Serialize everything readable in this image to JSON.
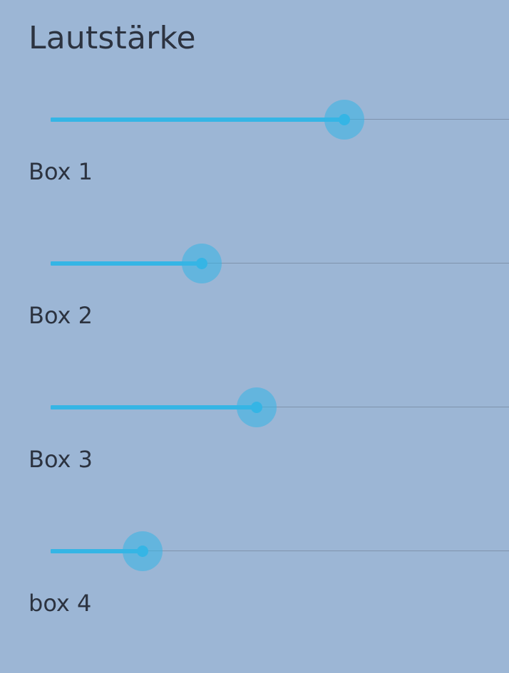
{
  "header": {
    "title": "Lautstärke"
  },
  "colors": {
    "background": "#9cb6d5",
    "accent": "#35b5e5",
    "text": "#2c3340",
    "track": "#7f93ac"
  },
  "sliders": [
    {
      "label": "Box 1",
      "value": 0.64
    },
    {
      "label": "Box 2",
      "value": 0.33
    },
    {
      "label": "Box 3",
      "value": 0.45
    },
    {
      "label": "box 4",
      "value": 0.2
    }
  ]
}
